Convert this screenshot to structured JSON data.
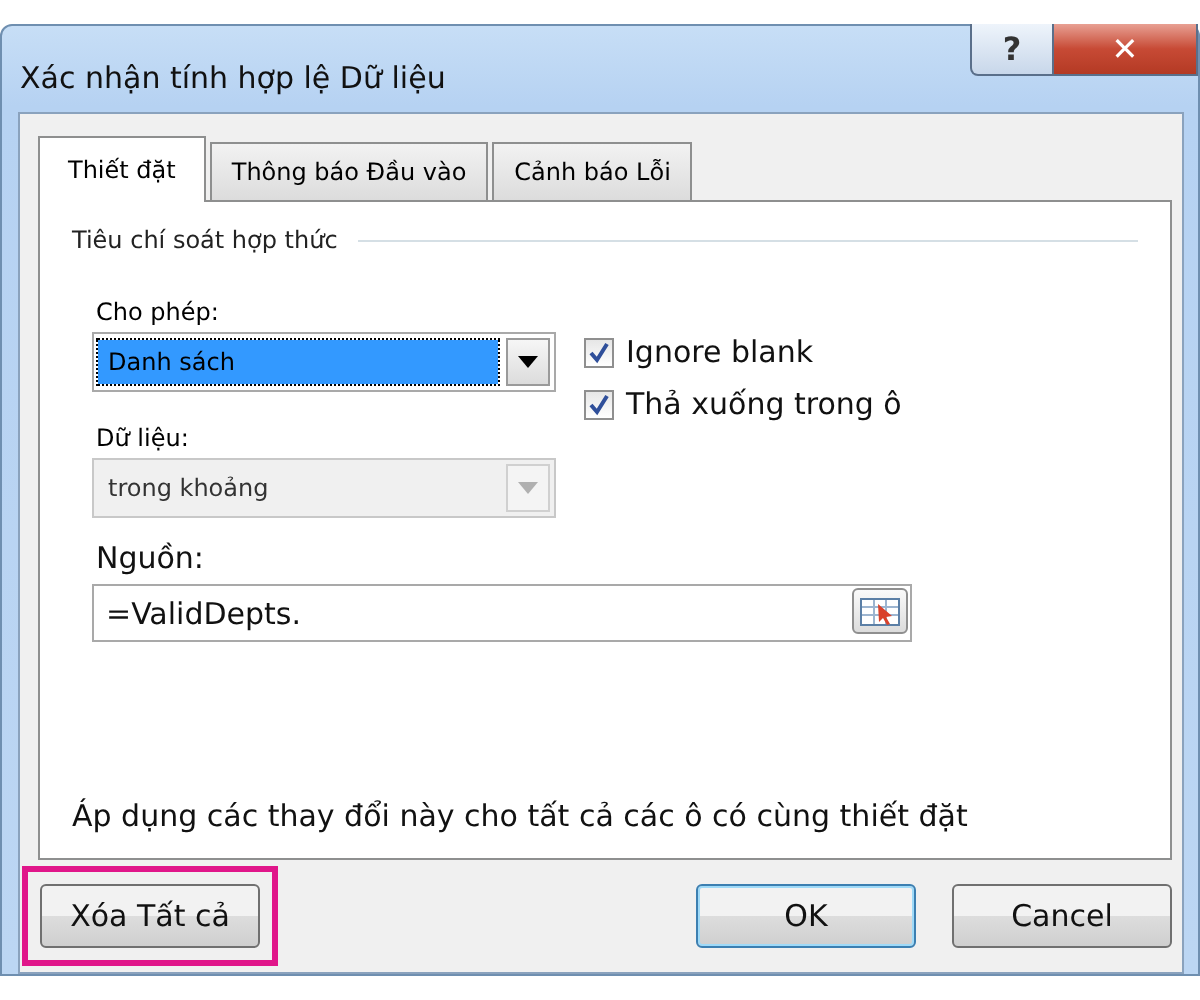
{
  "window": {
    "title": "Xác nhận tính hợp lệ Dữ liệu",
    "help": "?",
    "close": "✕"
  },
  "tabs": [
    {
      "label": "Thiết đặt",
      "selected": true
    },
    {
      "label": "Thông báo Đầu vào",
      "selected": false
    },
    {
      "label": "Cảnh báo Lỗi",
      "selected": false
    }
  ],
  "criteria": {
    "title": "Tiêu chí soát hợp thức",
    "allow": {
      "label": "Cho phép:",
      "value": "Danh sách",
      "disabled": false
    },
    "data": {
      "label": "Dữ liệu:",
      "value": "trong khoảng",
      "disabled": true
    },
    "checkboxes": [
      {
        "label": "Ignore blank",
        "checked": true
      },
      {
        "label": "Thả xuống trong ô",
        "checked": true
      }
    ],
    "source": {
      "label": "Nguồn:",
      "value": "=ValidDepts."
    }
  },
  "apply_all": {
    "label": "Áp dụng các thay đổi này cho tất cả các ô có cùng thiết đặt"
  },
  "buttons": [
    {
      "label": "Xóa Tất cả",
      "kind": "clear",
      "highlighted": true
    },
    {
      "label": "OK",
      "kind": "default",
      "highlighted": false
    },
    {
      "label": "Cancel",
      "kind": "normal",
      "highlighted": false
    }
  ]
}
